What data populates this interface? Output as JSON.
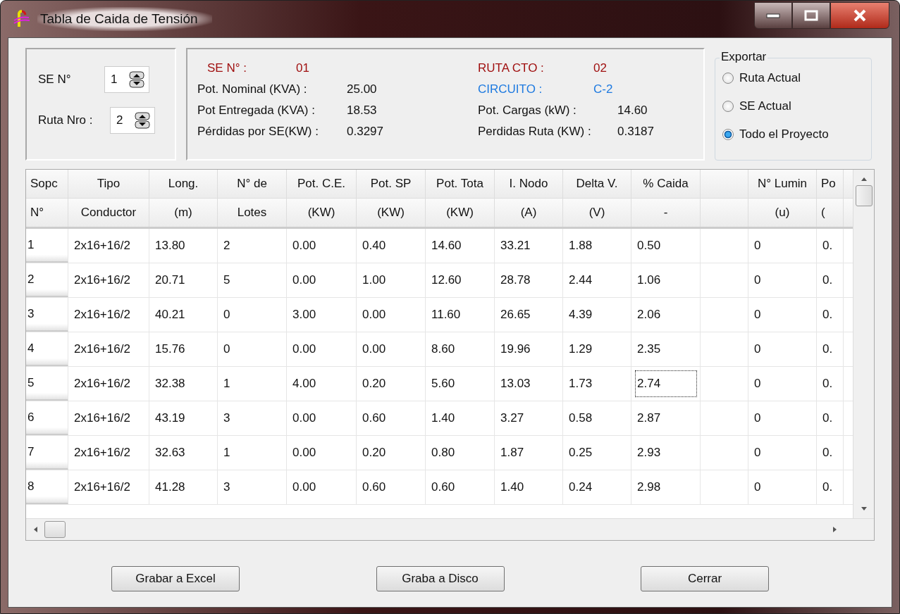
{
  "window": {
    "title": "Tabla de Caida de Tensión"
  },
  "selectors": [
    {
      "label": "SE N°",
      "value": "1"
    },
    {
      "label": "Ruta Nro :",
      "value": "2"
    }
  ],
  "se_info": {
    "header": {
      "label": "SE N° :",
      "value": "01"
    },
    "lines": [
      {
        "label": "Pot. Nominal (KVA) :",
        "value": "25.00"
      },
      {
        "label": "Pot Entregada (KVA) :",
        "value": "18.53"
      },
      {
        "label": "Pérdidas por SE(KW) :",
        "value": "0.3297"
      }
    ]
  },
  "route_info": {
    "route": {
      "label": "RUTA CTO  :",
      "value": "02"
    },
    "circuit": {
      "label": "CIRCUITO   :",
      "value": "C-2"
    },
    "lines": [
      {
        "label": "Pot. Cargas (kW)   :",
        "value": "14.60"
      },
      {
        "label": "Perdidas Ruta (KW) :",
        "value": "0.3187"
      }
    ]
  },
  "export": {
    "title": "Exportar",
    "options": [
      {
        "label": "Ruta Actual",
        "selected": false
      },
      {
        "label": "SE Actual",
        "selected": false
      },
      {
        "label": "Todo el Proyecto",
        "selected": true
      }
    ]
  },
  "table": {
    "columns": [
      {
        "top": "Sopc",
        "bottom": "N°"
      },
      {
        "top": "Tipo",
        "bottom": "Conductor"
      },
      {
        "top": "Long.",
        "bottom": "(m)"
      },
      {
        "top": "N° de",
        "bottom": "Lotes"
      },
      {
        "top": "Pot. C.E.",
        "bottom": "(KW)"
      },
      {
        "top": "Pot. SP",
        "bottom": "(KW)"
      },
      {
        "top": "Pot. Tota",
        "bottom": "(KW)"
      },
      {
        "top": "I. Nodo",
        "bottom": "(A)"
      },
      {
        "top": "Delta V.",
        "bottom": "(V)"
      },
      {
        "top": "% Caida",
        "bottom": "-"
      },
      {},
      {
        "top": "N° Lumin",
        "bottom": "(u)"
      },
      {
        "top": "Po",
        "bottom": "("
      }
    ],
    "rows": [
      {
        "cells": [
          {
            "text": "1",
            "focused": false
          },
          {
            "text": "2x16+16/2",
            "focused": false
          },
          {
            "text": "13.80",
            "focused": false
          },
          {
            "text": "2",
            "focused": false
          },
          {
            "text": "0.00",
            "focused": false
          },
          {
            "text": "0.40",
            "focused": false
          },
          {
            "text": "14.60",
            "focused": false
          },
          {
            "text": "33.21",
            "focused": false
          },
          {
            "text": "1.88",
            "focused": false
          },
          {
            "text": "0.50",
            "focused": false
          },
          {
            "focused": false
          },
          {
            "text": "0",
            "focused": false
          },
          {
            "text": "0.",
            "focused": false
          }
        ]
      },
      {
        "cells": [
          {
            "text": "2",
            "focused": false
          },
          {
            "text": "2x16+16/2",
            "focused": false
          },
          {
            "text": "20.71",
            "focused": false
          },
          {
            "text": "5",
            "focused": false
          },
          {
            "text": "0.00",
            "focused": false
          },
          {
            "text": "1.00",
            "focused": false
          },
          {
            "text": "12.60",
            "focused": false
          },
          {
            "text": "28.78",
            "focused": false
          },
          {
            "text": "2.44",
            "focused": false
          },
          {
            "text": "1.06",
            "focused": false
          },
          {
            "focused": false
          },
          {
            "text": "0",
            "focused": false
          },
          {
            "text": "0.",
            "focused": false
          }
        ]
      },
      {
        "cells": [
          {
            "text": "3",
            "focused": false
          },
          {
            "text": "2x16+16/2",
            "focused": false
          },
          {
            "text": "40.21",
            "focused": false
          },
          {
            "text": "0",
            "focused": false
          },
          {
            "text": "3.00",
            "focused": false
          },
          {
            "text": "0.00",
            "focused": false
          },
          {
            "text": "11.60",
            "focused": false
          },
          {
            "text": "26.65",
            "focused": false
          },
          {
            "text": "4.39",
            "focused": false
          },
          {
            "text": "2.06",
            "focused": false
          },
          {
            "focused": false
          },
          {
            "text": "0",
            "focused": false
          },
          {
            "text": "0.",
            "focused": false
          }
        ]
      },
      {
        "cells": [
          {
            "text": "4",
            "focused": false
          },
          {
            "text": "2x16+16/2",
            "focused": false
          },
          {
            "text": "15.76",
            "focused": false
          },
          {
            "text": "0",
            "focused": false
          },
          {
            "text": "0.00",
            "focused": false
          },
          {
            "text": "0.00",
            "focused": false
          },
          {
            "text": "8.60",
            "focused": false
          },
          {
            "text": "19.96",
            "focused": false
          },
          {
            "text": "1.29",
            "focused": false
          },
          {
            "text": "2.35",
            "focused": false
          },
          {
            "focused": false
          },
          {
            "text": "0",
            "focused": false
          },
          {
            "text": "0.",
            "focused": false
          }
        ]
      },
      {
        "cells": [
          {
            "text": "5",
            "focused": false
          },
          {
            "text": "2x16+16/2",
            "focused": false
          },
          {
            "text": "32.38",
            "focused": false
          },
          {
            "text": "1",
            "focused": false
          },
          {
            "text": "4.00",
            "focused": false
          },
          {
            "text": "0.20",
            "focused": false
          },
          {
            "text": "5.60",
            "focused": false
          },
          {
            "text": "13.03",
            "focused": false
          },
          {
            "text": "1.73",
            "focused": false
          },
          {
            "text": "2.74",
            "focused": true
          },
          {
            "focused": false
          },
          {
            "text": "0",
            "focused": false
          },
          {
            "text": "0.",
            "focused": false
          }
        ]
      },
      {
        "cells": [
          {
            "text": "6",
            "focused": false
          },
          {
            "text": "2x16+16/2",
            "focused": false
          },
          {
            "text": "43.19",
            "focused": false
          },
          {
            "text": "3",
            "focused": false
          },
          {
            "text": "0.00",
            "focused": false
          },
          {
            "text": "0.60",
            "focused": false
          },
          {
            "text": "1.40",
            "focused": false
          },
          {
            "text": "3.27",
            "focused": false
          },
          {
            "text": "0.58",
            "focused": false
          },
          {
            "text": "2.87",
            "focused": false
          },
          {
            "focused": false
          },
          {
            "text": "0",
            "focused": false
          },
          {
            "text": "0.",
            "focused": false
          }
        ]
      },
      {
        "cells": [
          {
            "text": "7",
            "focused": false
          },
          {
            "text": "2x16+16/2",
            "focused": false
          },
          {
            "text": "32.63",
            "focused": false
          },
          {
            "text": "1",
            "focused": false
          },
          {
            "text": "0.00",
            "focused": false
          },
          {
            "text": "0.20",
            "focused": false
          },
          {
            "text": "0.80",
            "focused": false
          },
          {
            "text": "1.87",
            "focused": false
          },
          {
            "text": "0.25",
            "focused": false
          },
          {
            "text": "2.93",
            "focused": false
          },
          {
            "focused": false
          },
          {
            "text": "0",
            "focused": false
          },
          {
            "text": "0.",
            "focused": false
          }
        ]
      },
      {
        "cells": [
          {
            "text": "8",
            "focused": false
          },
          {
            "text": "2x16+16/2",
            "focused": false
          },
          {
            "text": "41.28",
            "focused": false
          },
          {
            "text": "3",
            "focused": false
          },
          {
            "text": "0.00",
            "focused": false
          },
          {
            "text": "0.60",
            "focused": false
          },
          {
            "text": "0.60",
            "focused": false
          },
          {
            "text": "1.40",
            "focused": false
          },
          {
            "text": "0.24",
            "focused": false
          },
          {
            "text": "2.98",
            "focused": false
          },
          {
            "focused": false
          },
          {
            "text": "0",
            "focused": false
          },
          {
            "text": "0.",
            "focused": false
          }
        ]
      }
    ]
  },
  "buttons": [
    {
      "label": "Grabar a Excel"
    },
    {
      "label": "Graba a Disco"
    },
    {
      "label": "Cerrar"
    }
  ]
}
